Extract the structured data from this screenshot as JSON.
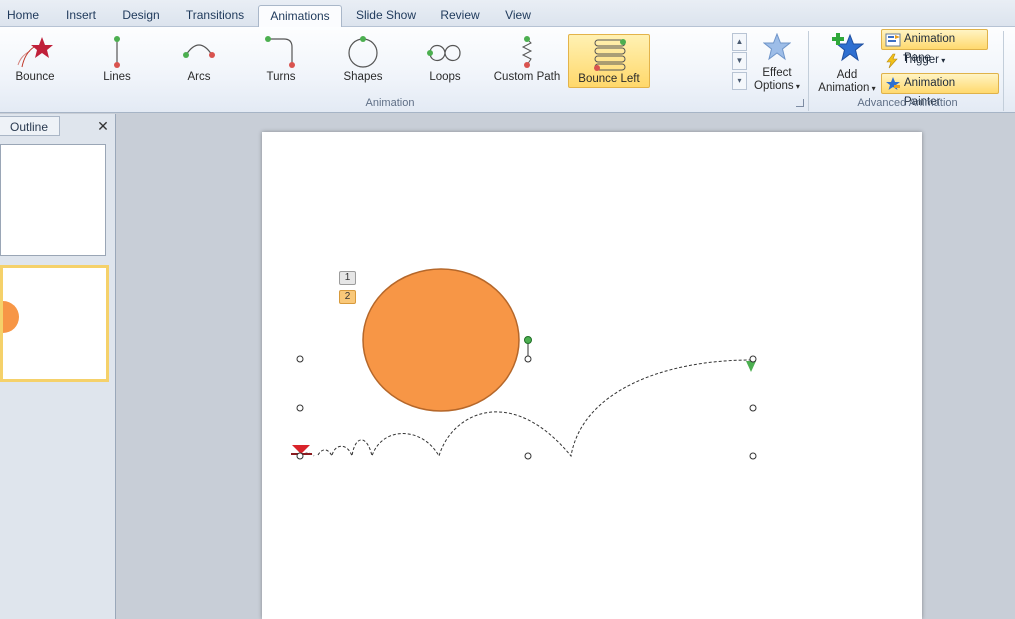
{
  "tabs": [
    "Home",
    "Insert",
    "Design",
    "Transitions",
    "Animations",
    "Slide Show",
    "Review",
    "View"
  ],
  "active_tab": "Animations",
  "gallery": [
    {
      "label": "Bounce",
      "icon": "bounce-star-icon"
    },
    {
      "label": "Lines",
      "icon": "lines-path-icon"
    },
    {
      "label": "Arcs",
      "icon": "arcs-path-icon"
    },
    {
      "label": "Turns",
      "icon": "turns-path-icon"
    },
    {
      "label": "Shapes",
      "icon": "shapes-path-icon"
    },
    {
      "label": "Loops",
      "icon": "loops-path-icon"
    },
    {
      "label": "Custom Path",
      "icon": "custom-path-icon"
    },
    {
      "label": "Bounce Left",
      "icon": "bounce-left-icon",
      "selected": true
    }
  ],
  "effect_options": {
    "line1": "Effect",
    "line2": "Options"
  },
  "group_animation": "Animation",
  "add_animation": {
    "line1": "Add",
    "line2": "Animation"
  },
  "advanced": {
    "animation_pane": "Animation Pane",
    "trigger": "Trigger",
    "animation_painter": "Animation Painter",
    "group_label": "Advanced Animation"
  },
  "left_pane": {
    "outline_tab": "Outline",
    "close": "✕"
  },
  "slide": {
    "tags": [
      "1",
      "2"
    ],
    "circle_color": "#f79646",
    "circle_stroke": "#b5672a"
  },
  "colors": {
    "highlight": "#ffd86b",
    "accent": "#1e395b"
  }
}
